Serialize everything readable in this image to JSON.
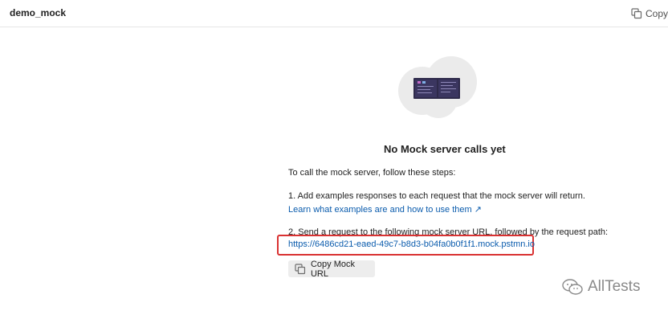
{
  "header": {
    "title": "demo_mock",
    "copy_button_label": "Copy U"
  },
  "empty_state": {
    "heading": "No Mock server calls yet",
    "intro": "To call the mock server, follow these steps:",
    "step1": "1. Add examples responses to each request that the mock server will return.",
    "step1_link": "Learn what examples are and how to use them ↗",
    "step2": "2. Send a request to the following mock server URL, followed by the request path:",
    "mock_url": "https://6486cd21-eaed-49c7-b8d3-b04fa0b0f1f1.mock.pstmn.io",
    "copy_mock_label": "Copy Mock URL"
  },
  "watermark": {
    "text": "AllTests"
  },
  "icons": {
    "copy": "copy-icon",
    "illustration": "server-illustration-icon",
    "watermark": "wechat-icon"
  },
  "colors": {
    "link": "#0b5cad",
    "highlight_border": "#d93232",
    "button_bg": "#ededed"
  }
}
